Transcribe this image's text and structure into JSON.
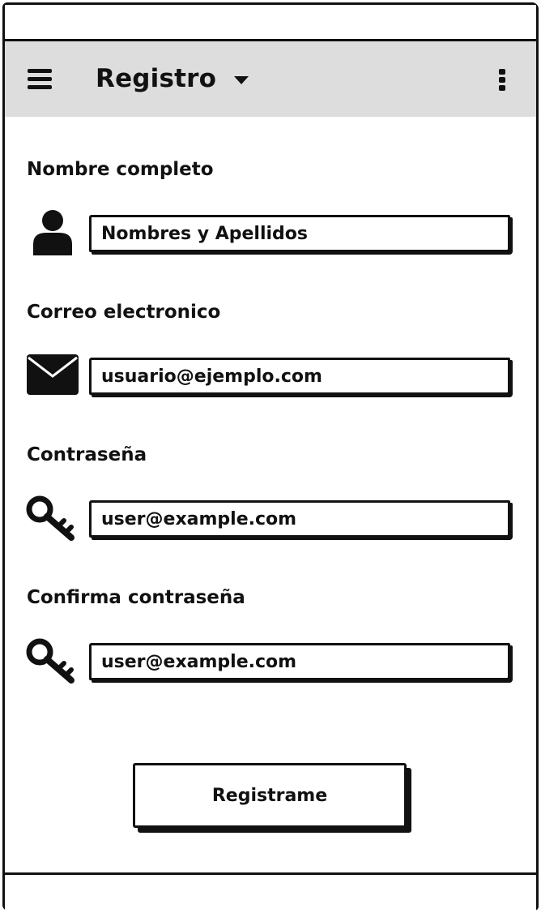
{
  "appbar": {
    "title": "Registro",
    "menu_icon": "hamburger-menu-icon",
    "dropdown_icon": "caret-down-icon",
    "more_icon": "vertical-ellipsis-icon"
  },
  "form": {
    "name": {
      "label": "Nombre completo",
      "placeholder": "Nombres y Apellidos",
      "icon": "user-icon"
    },
    "email": {
      "label": "Correo electronico",
      "placeholder": "usuario@ejemplo.com",
      "icon": "envelope-icon"
    },
    "password": {
      "label": "Contraseña",
      "placeholder": "user@example.com",
      "icon": "key-icon"
    },
    "confirm_password": {
      "label": "Confirma contraseña",
      "placeholder": "user@example.com",
      "icon": "key-icon"
    },
    "submit_label": "Registrame"
  }
}
